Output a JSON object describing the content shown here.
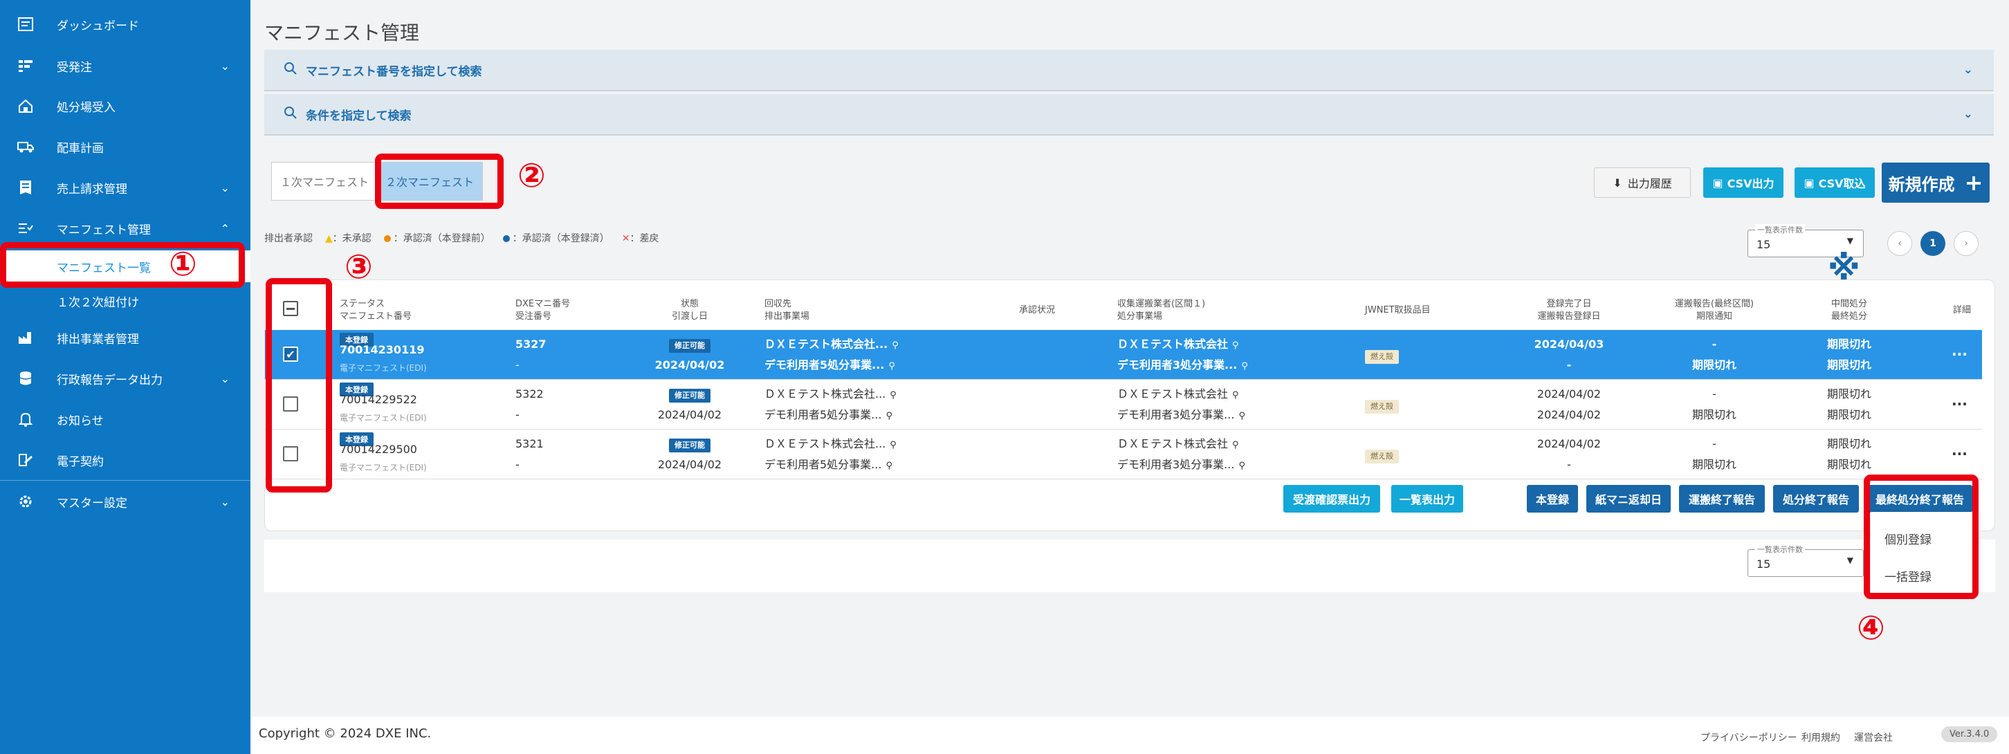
{
  "sidebar": {
    "items": [
      {
        "label": "ダッシュボード",
        "icon": "dashboard-icon"
      },
      {
        "label": "受発注",
        "icon": "orders-icon"
      },
      {
        "label": "処分場受入",
        "icon": "facility-icon"
      },
      {
        "label": "配車計画",
        "icon": "truck-icon"
      },
      {
        "label": "売上請求管理",
        "icon": "billing-icon"
      },
      {
        "label": "マニフェスト管理",
        "icon": "manifest-icon"
      },
      {
        "label": "排出事業者管理",
        "icon": "factory-icon"
      },
      {
        "label": "行政報告データ出力",
        "icon": "database-icon"
      },
      {
        "label": "お知らせ",
        "icon": "bell-icon"
      },
      {
        "label": "電子契約",
        "icon": "contract-icon"
      },
      {
        "label": "マスター設定",
        "icon": "gear-icon"
      }
    ],
    "sub_items": [
      "マニフェスト一覧",
      "１次２次紐付け"
    ]
  },
  "page": {
    "title": "マニフェスト管理"
  },
  "search": {
    "by_number": "マニフェスト番号を指定して検索",
    "by_condition": "条件を指定して検索"
  },
  "toggle": {
    "primary": "１次マニフェスト",
    "secondary": "２次マニフェスト"
  },
  "toolbar": {
    "history": "出力履歴",
    "csv_out": "CSV出力",
    "csv_in": "CSV取込",
    "new": "新規作成"
  },
  "legend": {
    "title": "排出者承認",
    "unapproved": "：未承認",
    "approved_unreg": "：承認済（本登録前）",
    "approved_reg": "：承認済（本登録済）",
    "rejected": "：差戻",
    "colors": {
      "unapproved": "#f2c200",
      "approved_unreg": "#f08a00",
      "approved_reg": "#1867a8",
      "rejected": "#e05050"
    }
  },
  "page_size": {
    "caption": "一覧表示件数",
    "value": "15"
  },
  "pager": {
    "current": "1"
  },
  "table": {
    "headers": {
      "status": [
        "ステータス",
        "マニフェスト番号"
      ],
      "dxe": [
        "DXEマニ番号",
        "受注番号"
      ],
      "state": [
        "状態",
        "引渡し日"
      ],
      "collect": [
        "回収先",
        "排出事業場"
      ],
      "approval": [
        "承認状況"
      ],
      "transport": [
        "収集運搬業者(区間１)",
        "処分事業場"
      ],
      "jwnet": [
        "JWNET取扱品目"
      ],
      "registered": [
        "登録完了日",
        "運搬報告登録日"
      ],
      "report": [
        "運搬報告(最終区間)",
        "期限通知"
      ],
      "disposal": [
        "中間処分",
        "最終処分"
      ],
      "detail": [
        "詳細"
      ]
    },
    "rows": [
      {
        "status": "本登録",
        "manifest_no": "70014230119",
        "edi": "電子マニフェスト(EDI)",
        "dxe_no": "5327",
        "order_no": "-",
        "state": "修正可能",
        "date": "2024/04/02",
        "collect": "ＤＸＥテスト株式会社...",
        "site": "デモ利用者5処分事業...",
        "transport": "ＤＸＥテスト株式会社",
        "facility": "デモ利用者3処分事業...",
        "item": "燃え殻",
        "reg_date": "2024/04/03",
        "report_date": "-",
        "report": "-",
        "deadline": "期限切れ",
        "mid": "期限切れ",
        "final": "期限切れ",
        "more": "···"
      },
      {
        "status": "本登録",
        "manifest_no": "70014229522",
        "edi": "電子マニフェスト(EDI)",
        "dxe_no": "5322",
        "order_no": "-",
        "state": "修正可能",
        "date": "2024/04/02",
        "collect": "ＤＸＥテスト株式会社...",
        "site": "デモ利用者5処分事業...",
        "transport": "ＤＸＥテスト株式会社",
        "facility": "デモ利用者3処分事業...",
        "item": "燃え殻",
        "reg_date": "2024/04/02",
        "report_date": "2024/04/02",
        "report": "-",
        "deadline": "期限切れ",
        "mid": "期限切れ",
        "final": "期限切れ",
        "more": "···"
      },
      {
        "status": "本登録",
        "manifest_no": "70014229500",
        "edi": "電子マニフェスト(EDI)",
        "dxe_no": "5321",
        "order_no": "-",
        "state": "修正可能",
        "date": "2024/04/02",
        "collect": "ＤＸＥテスト株式会社...",
        "site": "デモ利用者5処分事業...",
        "transport": "ＤＸＥテスト株式会社",
        "facility": "デモ利用者3処分事業...",
        "item": "燃え殻",
        "reg_date": "2024/04/02",
        "report_date": "-",
        "report": "-",
        "deadline": "期限切れ",
        "mid": "期限切れ",
        "final": "期限切れ",
        "more": "···"
      }
    ]
  },
  "actions": {
    "receipt": "受渡確認票出力",
    "list_out": "一覧表出力",
    "register": "本登録",
    "paper_return": "紙マニ返却日",
    "transport_end": "運搬終了報告",
    "disposal_end": "処分終了報告",
    "final_end": "最終処分終了報告"
  },
  "dropdown": {
    "individual": "個別登録",
    "bulk": "一括登録"
  },
  "annotations": {
    "one": "①",
    "two": "②",
    "three": "③",
    "four": "④",
    "note": "※"
  },
  "footer": {
    "copyright": "Copyright © 2024 DXE INC.",
    "privacy": "プライバシーポリシー",
    "terms": "利用規約",
    "company": "運営会社",
    "version": "Ver.3.4.0"
  }
}
